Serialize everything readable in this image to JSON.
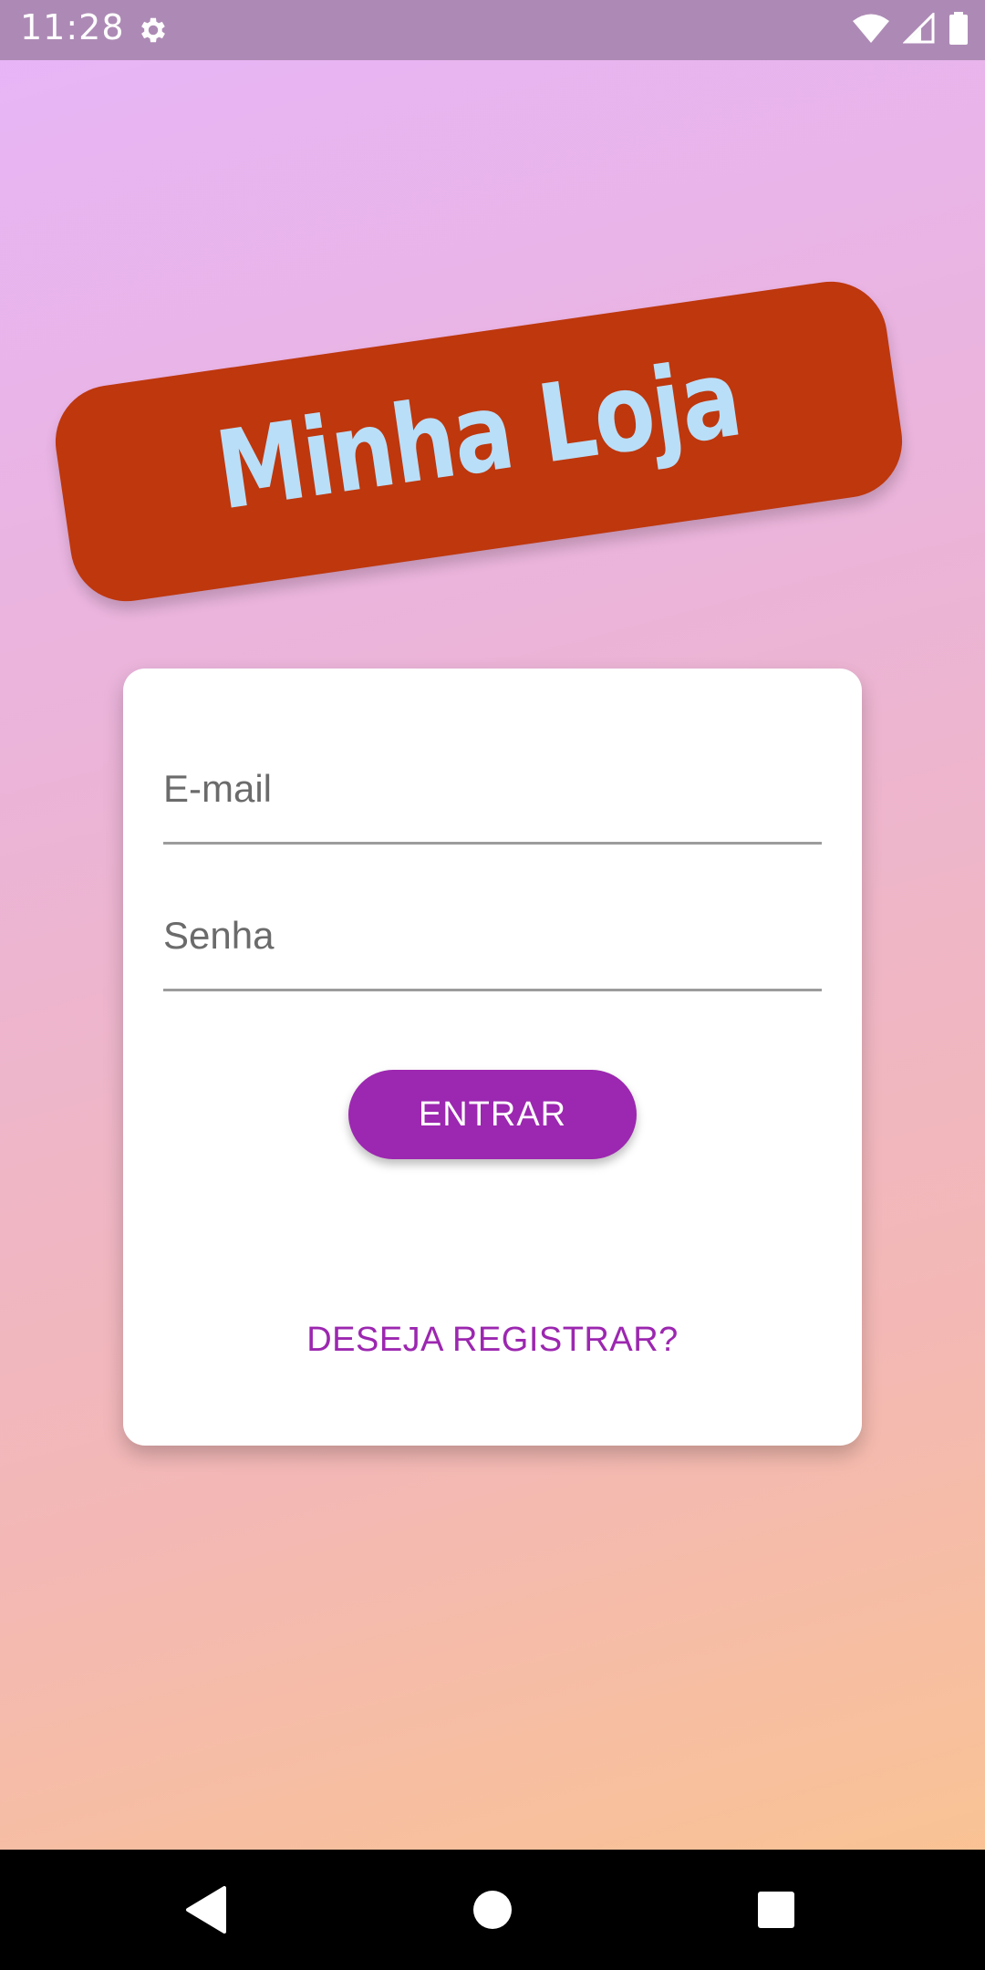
{
  "status_bar": {
    "time": "11:28",
    "icons": [
      "gear-icon",
      "wifi-icon",
      "signal-icon",
      "battery-icon"
    ]
  },
  "logo": {
    "text": "Minha Loja"
  },
  "login_form": {
    "email_placeholder": "E-mail",
    "password_placeholder": "Senha",
    "enter_button_label": "ENTRAR",
    "register_link_label": "DESEJA REGISTRAR?"
  },
  "navigation_bar": {
    "buttons": [
      "back-icon",
      "home-icon",
      "recents-icon"
    ]
  },
  "colors": {
    "accent": "#9c27b0",
    "logo_background": "#be370d",
    "logo_text": "#b9def8",
    "status_bar": "#ad8ab5"
  }
}
